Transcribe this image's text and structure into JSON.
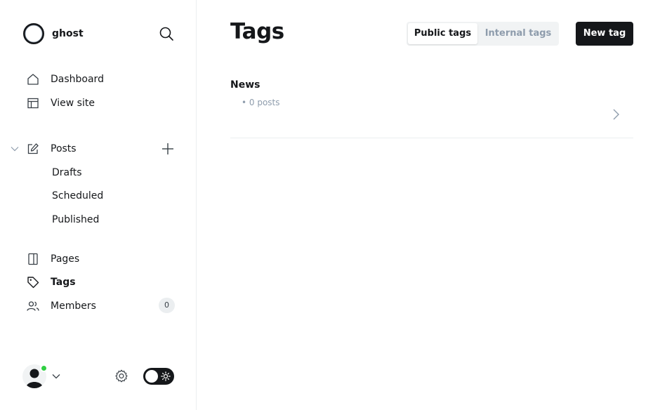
{
  "sidebar": {
    "brand": "ghost",
    "nav": {
      "dashboard": "Dashboard",
      "view_site": "View site",
      "posts": "Posts",
      "drafts": "Drafts",
      "scheduled": "Scheduled",
      "published": "Published",
      "pages": "Pages",
      "tags": "Tags",
      "members": "Members"
    },
    "members_count": "0",
    "icons": [
      "search-icon",
      "home-icon",
      "layout-icon",
      "pencil-icon",
      "plus-icon",
      "book-icon",
      "tag-icon",
      "members-icon",
      "gear-icon",
      "sun-icon"
    ],
    "status_color": "#30cf43"
  },
  "main": {
    "title": "Tags",
    "tabs": {
      "public": "Public tags",
      "internal": "Internal tags"
    },
    "new_button": "New tag",
    "tags": [
      {
        "name": "News",
        "count": "• 0 posts"
      }
    ]
  },
  "colors": {
    "primary": "#15171a",
    "muted": "#8e9cac",
    "border": "#ebeef0",
    "accent": "#30cf43"
  }
}
